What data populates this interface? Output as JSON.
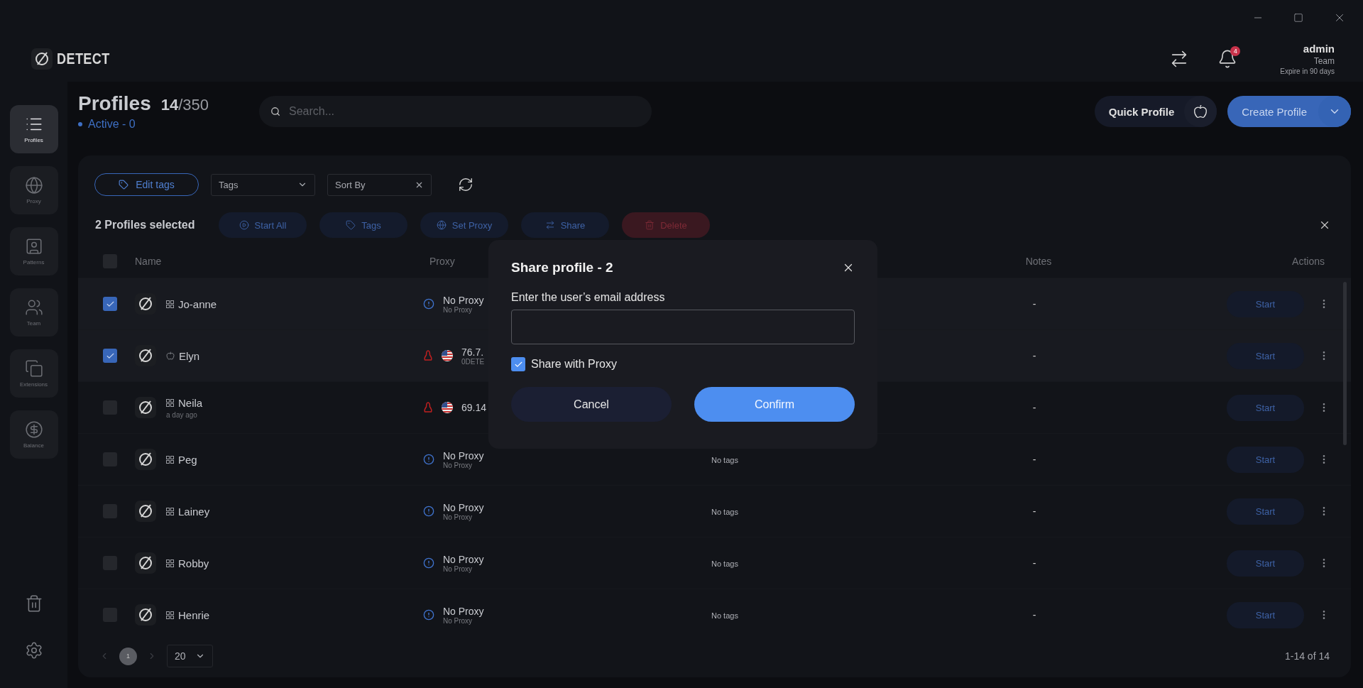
{
  "brand": "DETECT",
  "header": {
    "notifications": "4",
    "user": {
      "name": "admin",
      "plan": "Team",
      "expiry": "Expire in 90 days"
    }
  },
  "sidebar": {
    "items": [
      {
        "kind": "profiles",
        "label": "Profiles",
        "selected": true
      },
      {
        "kind": "proxy",
        "label": "Proxy",
        "selected": false
      },
      {
        "kind": "patterns",
        "label": "Patterns",
        "selected": false
      },
      {
        "kind": "team",
        "label": "Team",
        "selected": false
      },
      {
        "kind": "extensions",
        "label": "Extensions",
        "selected": false
      },
      {
        "kind": "balance",
        "label": "Balance",
        "selected": false
      }
    ]
  },
  "page": {
    "title": "Profiles",
    "count": "**14**/350",
    "active": "Active - 0"
  },
  "search": {
    "placeholder": "Search..."
  },
  "quick_profile": "Quick Profile",
  "create_profile": "Create Profile",
  "filters": {
    "edit_tags": "Edit tags",
    "tags": "Tags",
    "sort": "Sort By"
  },
  "selection": {
    "label": "2 Profiles selected",
    "actions": [
      {
        "kind": "start",
        "label": "Start All"
      },
      {
        "kind": "tags",
        "label": "Tags"
      },
      {
        "kind": "proxy",
        "label": "Set Proxy"
      },
      {
        "kind": "share",
        "label": "Share"
      },
      {
        "kind": "delete",
        "label": "Delete"
      }
    ]
  },
  "table": {
    "select_all": {
      "checked": false
    },
    "columns": [
      "Name",
      "Proxy",
      "Notes",
      "Actions"
    ],
    "rows": [
      {
        "name": "Jo-anne",
        "kind": "windows",
        "checked": true,
        "proxy": {
          "kind": "none",
          "title": "No Proxy",
          "subtitle": "No Proxy"
        },
        "notes": "-",
        "action": "Start"
      },
      {
        "name": "Elyn",
        "kind": "mac",
        "checked": true,
        "proxy": {
          "kind": "ip",
          "title": "76.7.",
          "subtitle": "0DETE"
        },
        "notes": "-",
        "action": "Start"
      },
      {
        "name": "Neila",
        "age": "a day ago",
        "kind": "windows",
        "checked": false,
        "proxy": {
          "kind": "ip",
          "title": "69.14"
        },
        "notes": "-",
        "action": "Start"
      },
      {
        "name": "Peg",
        "kind": "windows",
        "checked": false,
        "proxy": {
          "kind": "none",
          "title": "No Proxy",
          "subtitle": "No Proxy"
        },
        "tags": "No tags",
        "notes": "-",
        "action": "Start"
      },
      {
        "name": "Lainey",
        "kind": "windows",
        "checked": false,
        "proxy": {
          "kind": "none",
          "title": "No Proxy",
          "subtitle": "No Proxy"
        },
        "tags": "No tags",
        "notes": "-",
        "action": "Start"
      },
      {
        "name": "Robby",
        "kind": "windows",
        "checked": false,
        "proxy": {
          "kind": "none",
          "title": "No Proxy",
          "subtitle": "No Proxy"
        },
        "tags": "No tags",
        "notes": "-",
        "action": "Start"
      },
      {
        "name": "Henrie",
        "kind": "windows",
        "checked": false,
        "proxy": {
          "kind": "none",
          "title": "No Proxy",
          "subtitle": "No Proxy"
        },
        "tags": "No tags",
        "notes": "-",
        "action": "Start"
      }
    ]
  },
  "pagination": {
    "page": "1",
    "per_page": "20",
    "range": "1-14 of 14"
  },
  "dialog": {
    "title": "Share profile - 2",
    "label": "Enter the user’s email address",
    "share_with_proxy": {
      "label": "Share with Proxy",
      "checked": true
    },
    "cancel": "Cancel",
    "confirm": "Confirm"
  }
}
